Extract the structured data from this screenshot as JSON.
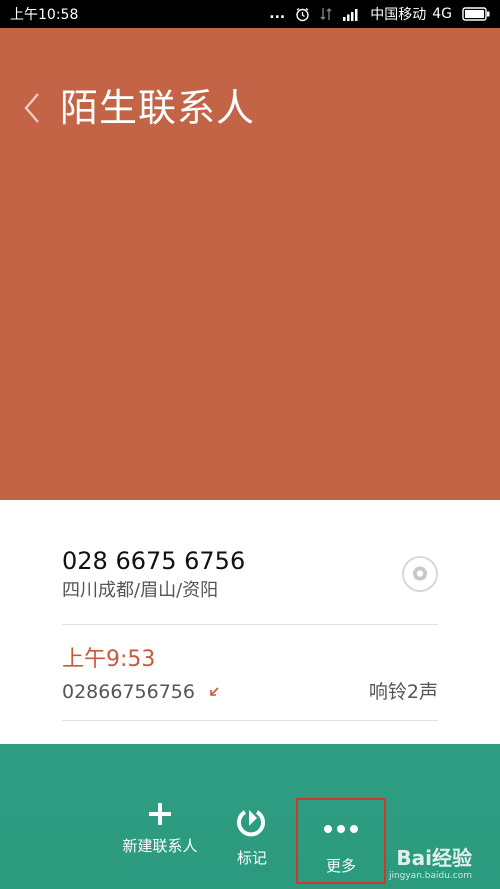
{
  "status": {
    "time": "上午10:58",
    "dots": "...",
    "carrier": "中国移动",
    "network": "4G"
  },
  "header": {
    "title": "陌生联系人",
    "bg_color": "#c36446"
  },
  "contact": {
    "phone": "028 6675 6756",
    "location": "四川成都/眉山/资阳"
  },
  "call_log": {
    "time": "上午9:53",
    "number": "02866756756",
    "ring_info": "响铃2声",
    "time_color": "#c8593d"
  },
  "actions": {
    "new_contact": "新建联系人",
    "mark": "标记",
    "more": "更多"
  },
  "watermark": {
    "brand": "Bai经验",
    "url": "jingyan.baidu.com"
  }
}
